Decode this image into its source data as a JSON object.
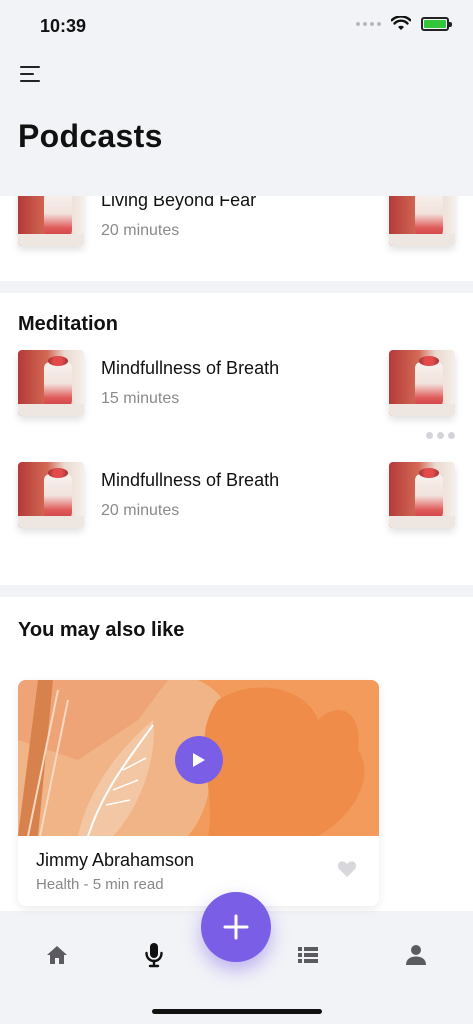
{
  "status": {
    "time": "10:39"
  },
  "header": {
    "title": "Podcasts"
  },
  "sections": {
    "partial_item": {
      "title": "Living Beyond Fear",
      "duration": "20 minutes"
    },
    "meditation": {
      "title": "Meditation",
      "items": [
        {
          "title": "Mindfullness of Breath",
          "duration": "15 minutes"
        },
        {
          "title": "Mindfullness of Breath",
          "duration": "20 minutes"
        }
      ]
    },
    "recommendations": {
      "title": "You may also like",
      "card": {
        "author": "Jimmy Abrahamson",
        "meta": "Health - 5 min read"
      }
    }
  },
  "icons": {
    "menu": "menu-icon",
    "home": "home-icon",
    "mic": "microphone-icon",
    "add": "plus-icon",
    "list": "list-icon",
    "profile": "user-icon",
    "play": "play-icon",
    "heart": "heart-icon"
  },
  "colors": {
    "accent": "#7a5fe6",
    "card_art": "#f0b486",
    "battery": "#35c53a"
  }
}
